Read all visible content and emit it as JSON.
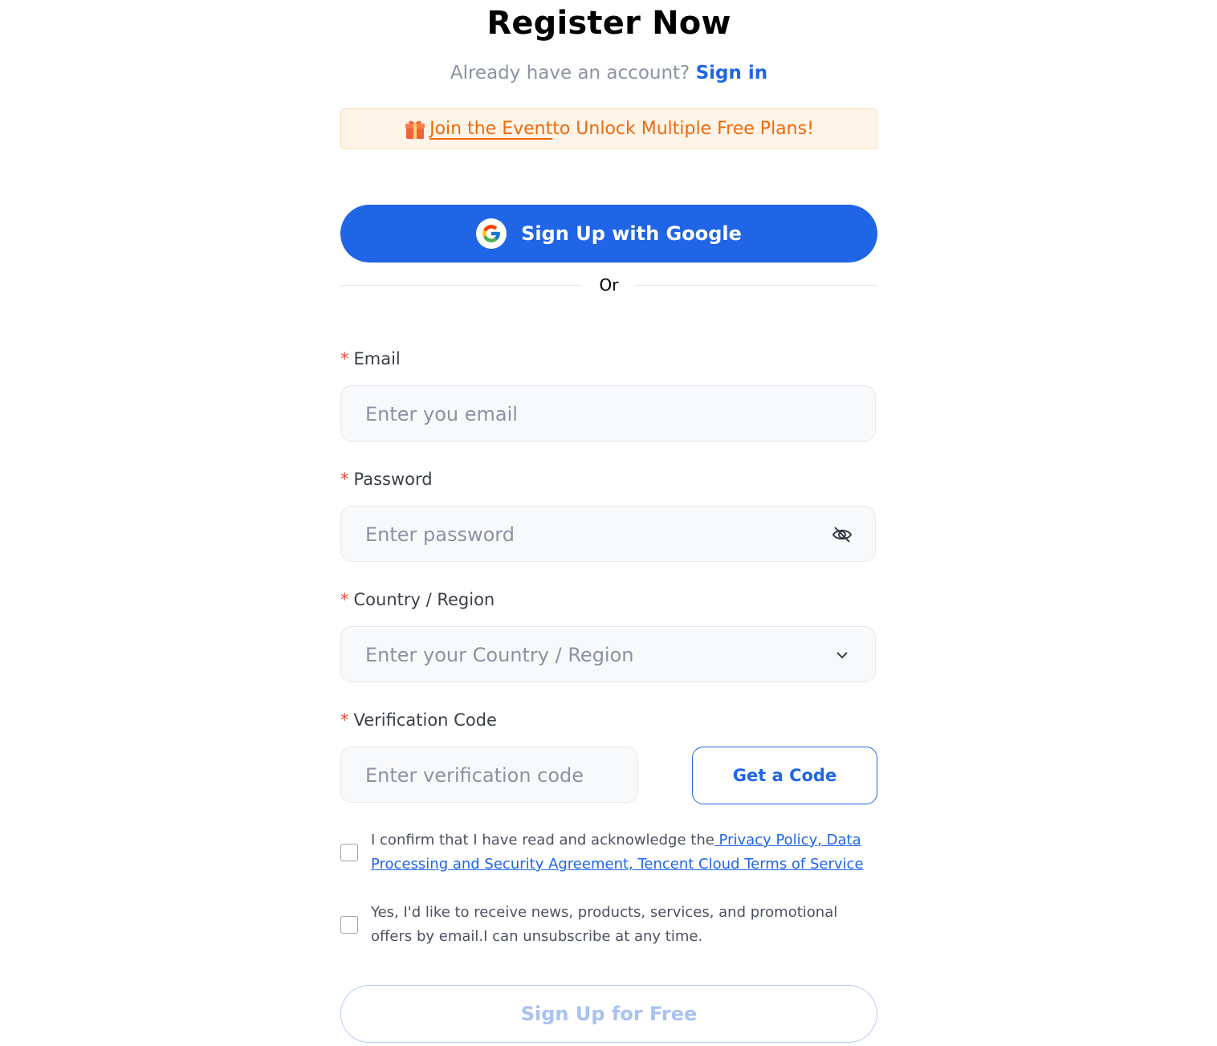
{
  "header": {
    "title": "Register Now",
    "subtitle_prefix": "Already have an account?",
    "signin_link": "Sign in"
  },
  "event_banner": {
    "icon": "gift-icon",
    "link_text": "Join the Event",
    "rest_text": " to Unlock Multiple Free Plans!"
  },
  "google_button": {
    "label": "Sign Up with Google",
    "icon": "google-icon"
  },
  "divider": {
    "text": "Or"
  },
  "fields": {
    "email": {
      "label": "Email",
      "placeholder": "Enter you email"
    },
    "password": {
      "label": "Password",
      "placeholder": "Enter password",
      "icon": "eye-hidden-icon"
    },
    "country": {
      "label": "Country / Region",
      "placeholder": "Enter your Country / Region",
      "icon": "chevron-down-icon"
    },
    "code": {
      "label": "Verification Code",
      "placeholder": "Enter verification code",
      "button": "Get a Code"
    }
  },
  "required_mark": "*",
  "agreements": {
    "privacy_prefix": "I confirm that I have read and acknowledge the",
    "privacy_link": " Privacy Policy, Data Processing and Security Agreement, Tencent Cloud Terms of Service",
    "privacy_checked": false,
    "news_text": "Yes, I'd like to receive news, products, services, and promotional offers by email.I can unsubscribe at any time.",
    "news_checked": false
  },
  "submit": {
    "label": "Sign Up for Free"
  },
  "colors": {
    "primary": "#1f65e6",
    "banner_bg": "#fff4e8",
    "banner_text": "#ee6a0c",
    "required": "#e5483d",
    "submit_disabled": "#a9c2f1"
  }
}
